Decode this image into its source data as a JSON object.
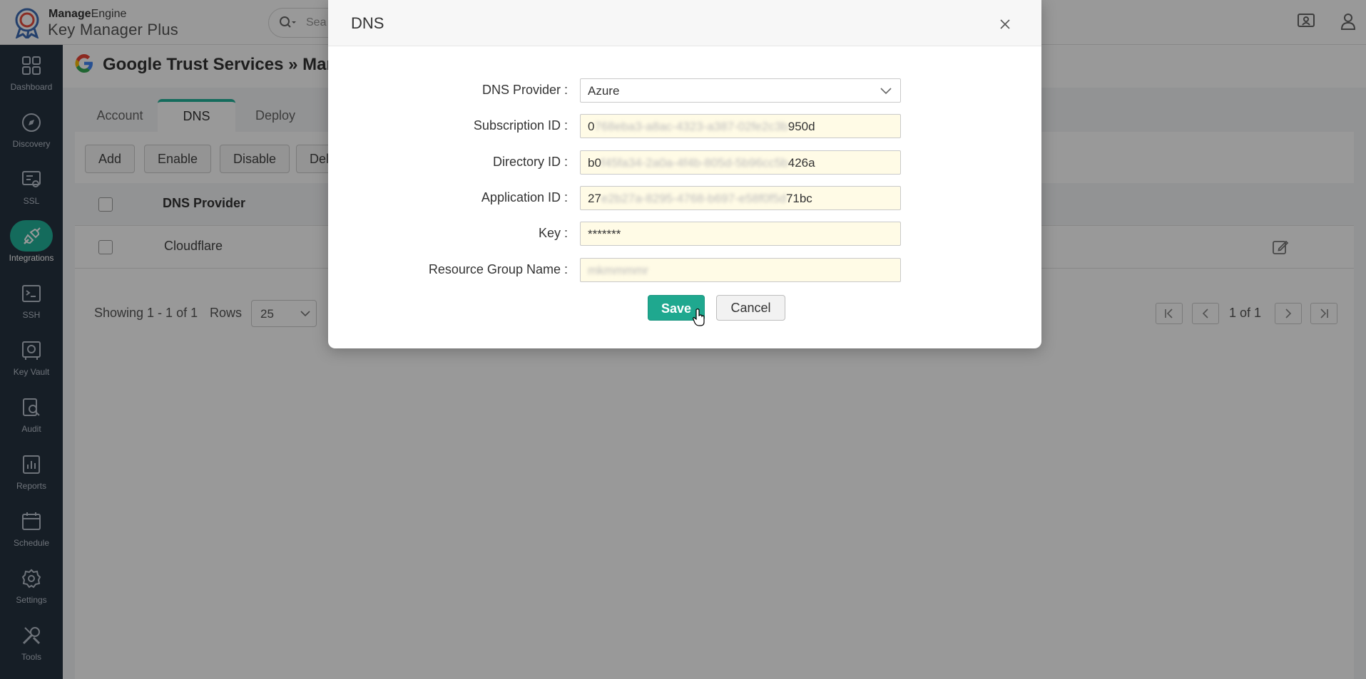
{
  "app": {
    "brand_top_a": "Manage",
    "brand_top_b": "Engine",
    "brand_bottom": "Key Manager Plus",
    "search_placeholder": "Sea"
  },
  "sidebar": {
    "items": [
      {
        "label": "Dashboard",
        "icon": "dashboard-icon"
      },
      {
        "label": "Discovery",
        "icon": "compass-icon"
      },
      {
        "label": "SSL",
        "icon": "certificate-icon"
      },
      {
        "label": "Integrations",
        "icon": "plug-icon",
        "active": true
      },
      {
        "label": "SSH",
        "icon": "terminal-icon"
      },
      {
        "label": "Key Vault",
        "icon": "safe-icon"
      },
      {
        "label": "Audit",
        "icon": "audit-search-icon"
      },
      {
        "label": "Reports",
        "icon": "reports-icon"
      },
      {
        "label": "Schedule",
        "icon": "calendar-icon"
      },
      {
        "label": "Settings",
        "icon": "gear-icon"
      },
      {
        "label": "Tools",
        "icon": "tools-icon"
      }
    ]
  },
  "page": {
    "title": "Google Trust Services » Mana",
    "tabs": [
      "Account",
      "DNS",
      "Deploy"
    ],
    "active_tab": "DNS",
    "toolbar": [
      "Add",
      "Enable",
      "Disable",
      "Del"
    ],
    "table": {
      "headers": [
        "DNS Provider"
      ],
      "rows": [
        [
          "Cloudflare"
        ]
      ]
    },
    "pager": {
      "showing": "Showing 1 - 1 of 1",
      "rows_label": "Rows",
      "rows_value": "25",
      "page_of": "1 of 1"
    }
  },
  "modal": {
    "title": "DNS",
    "fields": [
      {
        "label": "DNS Provider",
        "value": "Azure",
        "type": "select"
      },
      {
        "label": "Subscription ID",
        "value_start": "0",
        "value_hidden": "768eba3-a8ac-4323-a387-02fe2c3b",
        "value_end": "950d"
      },
      {
        "label": "Directory ID",
        "value_start": "b0",
        "value_hidden": "f45fa34-2a0a-4f4b-805d-5b96cc5b",
        "value_end": "426a"
      },
      {
        "label": "Application ID",
        "value_start": "27",
        "value_hidden": "e2b27a-8295-4768-b697-e58f0f5d",
        "value_end": "71bc"
      },
      {
        "label": "Key",
        "value": "*******"
      },
      {
        "label": "Resource Group Name",
        "value_hidden": "mkmmmmr"
      }
    ],
    "label_suffix": " :",
    "save_label": "Save",
    "cancel_label": "Cancel"
  },
  "colors": {
    "accent": "#22b39a",
    "sidebar": "#263240",
    "field_bg": "#fffbe6"
  }
}
